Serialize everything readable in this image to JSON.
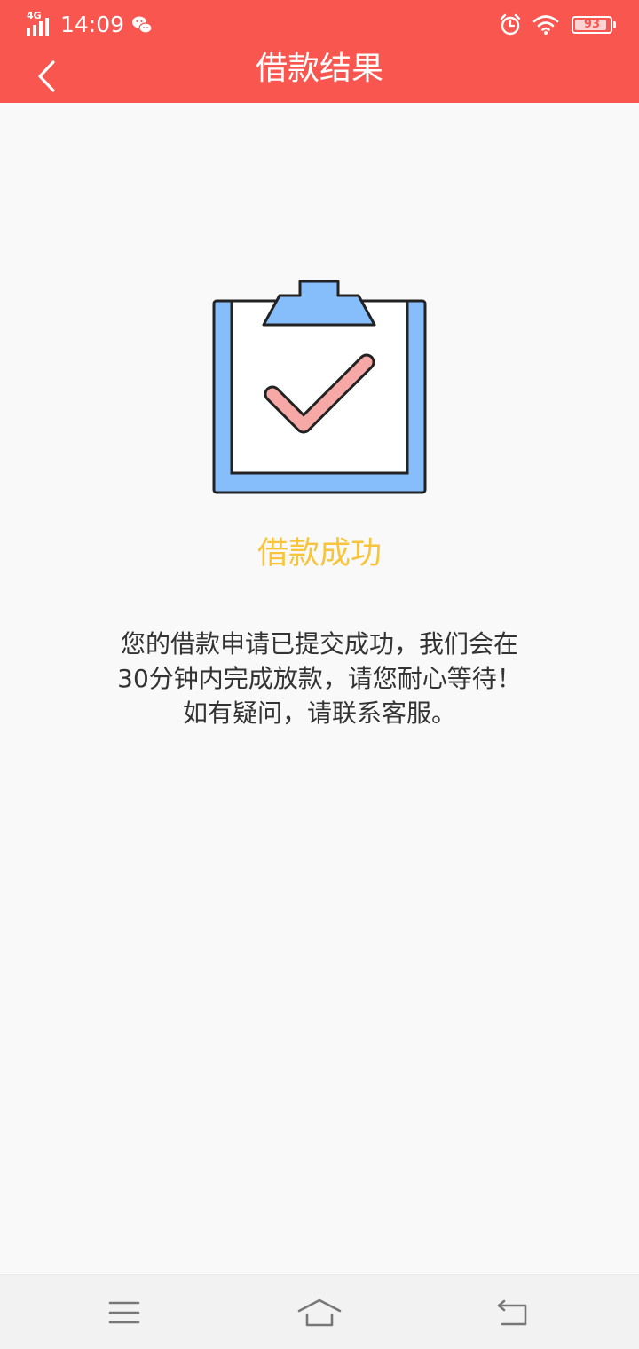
{
  "status_bar": {
    "network": "4G",
    "time": "14:09",
    "battery": "93",
    "battery_level": 0.93
  },
  "icons": {
    "back": "chevron-left-icon",
    "wechat": "wechat-icon",
    "alarm": "alarm-clock-icon",
    "wifi": "wifi-icon",
    "battery": "battery-icon",
    "illustration": "clipboard-check-icon",
    "menu": "menu-icon",
    "home": "home-icon",
    "return": "return-icon"
  },
  "header": {
    "title": "借款结果"
  },
  "result": {
    "status": "借款成功",
    "message_lines": [
      "您的借款申请已提交成功，我们会在",
      "30分钟内完成放款，请您耐心等待！",
      "如有疑问，请联系客服。"
    ]
  },
  "colors": {
    "header_bg": "#fa5650",
    "success_text": "#f7c43a",
    "clipboard_blue": "#86bdfb",
    "check_pink": "#f6a8a6",
    "page_bg": "#f9f9f9"
  }
}
